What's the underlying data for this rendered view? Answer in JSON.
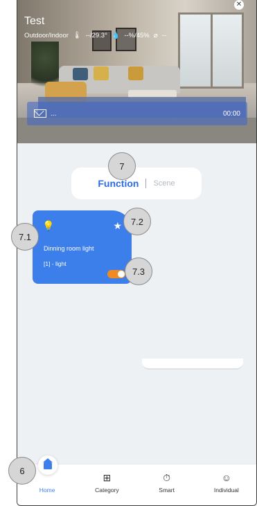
{
  "hero": {
    "title": "Test",
    "env_label": "Outdoor/Indoor",
    "temperature": "--/29.3°",
    "humidity": "--%/45%",
    "air": "--",
    "message_text": "...",
    "message_time": "00:00"
  },
  "tabs": {
    "active": "Function",
    "inactive": "Scene"
  },
  "device": {
    "name": "Dinning room light",
    "type": "[1] - light",
    "toggle_on": true
  },
  "nav": {
    "items": [
      {
        "label": "Home",
        "icon": "home-icon"
      },
      {
        "label": "Category",
        "icon": "category-icon"
      },
      {
        "label": "Smart",
        "icon": "smart-icon"
      },
      {
        "label": "Individual",
        "icon": "user-icon"
      }
    ]
  },
  "callouts": {
    "c6": "6",
    "c7": "7",
    "c71": "7.1",
    "c72": "7.2",
    "c73": "7.3"
  },
  "colors": {
    "accent": "#3d7fea",
    "toggle": "#f08a24"
  }
}
